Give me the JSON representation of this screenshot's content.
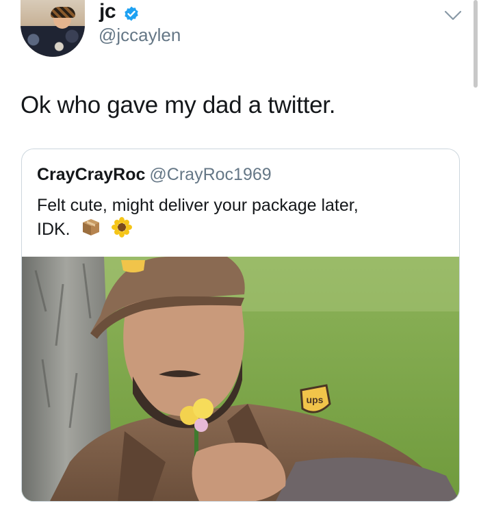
{
  "author": {
    "display_name": "jc",
    "handle": "@jccaylen",
    "verified": true
  },
  "tweet": {
    "text": "Ok who gave my dad a twitter."
  },
  "quoted_tweet": {
    "display_name": "CrayCrayRoc",
    "handle": "@CrayRoc1969",
    "text_line1": "Felt cute, might deliver your package later,",
    "text_line2": "IDK.",
    "emojis": [
      "package-icon",
      "sunflower-icon"
    ],
    "photo_logo_text": "ups"
  },
  "icons": {
    "verified_badge": "verified-badge-icon",
    "menu": "chevron-down-icon"
  },
  "colors": {
    "verified_blue": "#1da1f2",
    "handle_gray": "#657786",
    "border": "#ccd6dd",
    "ups_brown": "#7a5c43"
  }
}
